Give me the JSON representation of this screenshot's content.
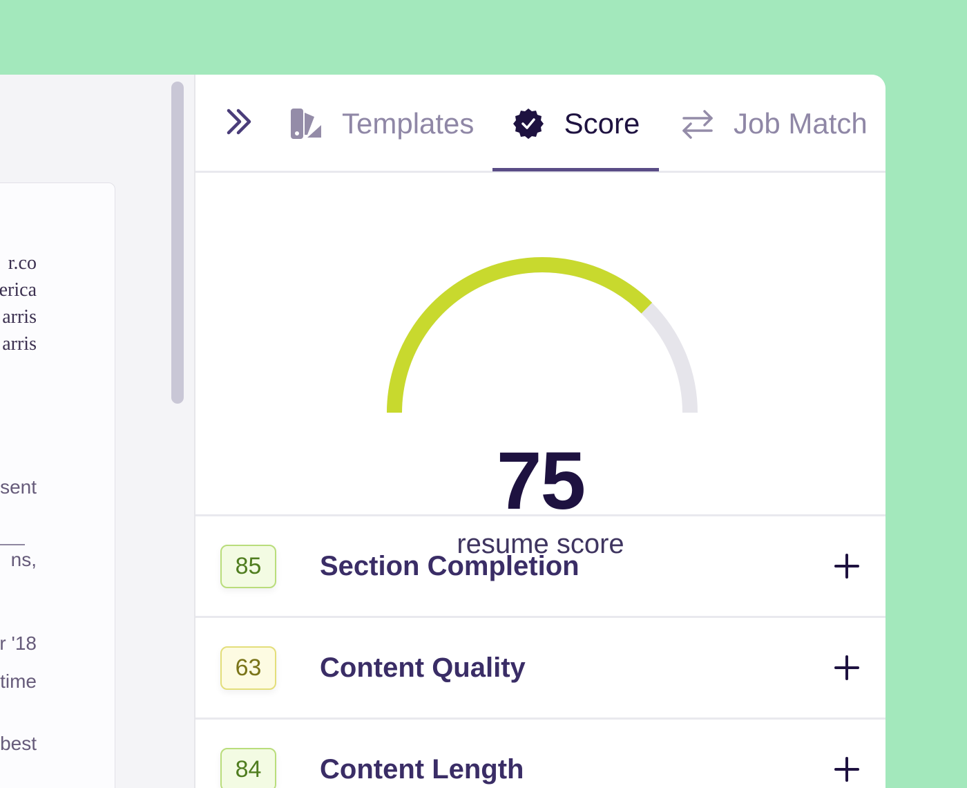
{
  "editor": {
    "lines": [
      {
        "text": "r.co",
        "style": "serif"
      },
      {
        "text": "erica",
        "style": "serif"
      },
      {
        "text": "arris",
        "style": "serif"
      },
      {
        "text": "arris",
        "style": "serif"
      },
      {
        "text": "sent",
        "style": "sans"
      },
      {
        "text": "ns,",
        "style": "sans"
      },
      {
        "text": "r '18",
        "style": "sans"
      },
      {
        "text": "n time",
        "style": "sans"
      },
      {
        "text": "e best",
        "style": "sans"
      }
    ]
  },
  "tabs": {
    "collapse_icon": "double-chevron-right-icon",
    "items": [
      {
        "label": "Templates",
        "icon": "templates-swatch-icon",
        "active": false
      },
      {
        "label": "Score",
        "icon": "verified-badge-icon",
        "active": true
      },
      {
        "label": "Job Match",
        "icon": "swap-arrows-icon",
        "active": false
      }
    ]
  },
  "score": {
    "value": "75",
    "max": 100,
    "caption": "resume score",
    "fill_color": "#c8d92e",
    "track_color": "#e6e5eb"
  },
  "sections": [
    {
      "score": "85",
      "title": "Section Completion",
      "badge_bg": "#f3fbe3",
      "badge_border": "#b9dd7b",
      "badge_text": "#4f7d1f"
    },
    {
      "score": "63",
      "title": "Content Quality",
      "badge_bg": "#fdfbe2",
      "badge_border": "#e3de7a",
      "badge_text": "#7a7418"
    },
    {
      "score": "84",
      "title": "Content Length",
      "badge_bg": "#f3fbe3",
      "badge_border": "#b9dd7b",
      "badge_text": "#4f7d1f"
    }
  ]
}
